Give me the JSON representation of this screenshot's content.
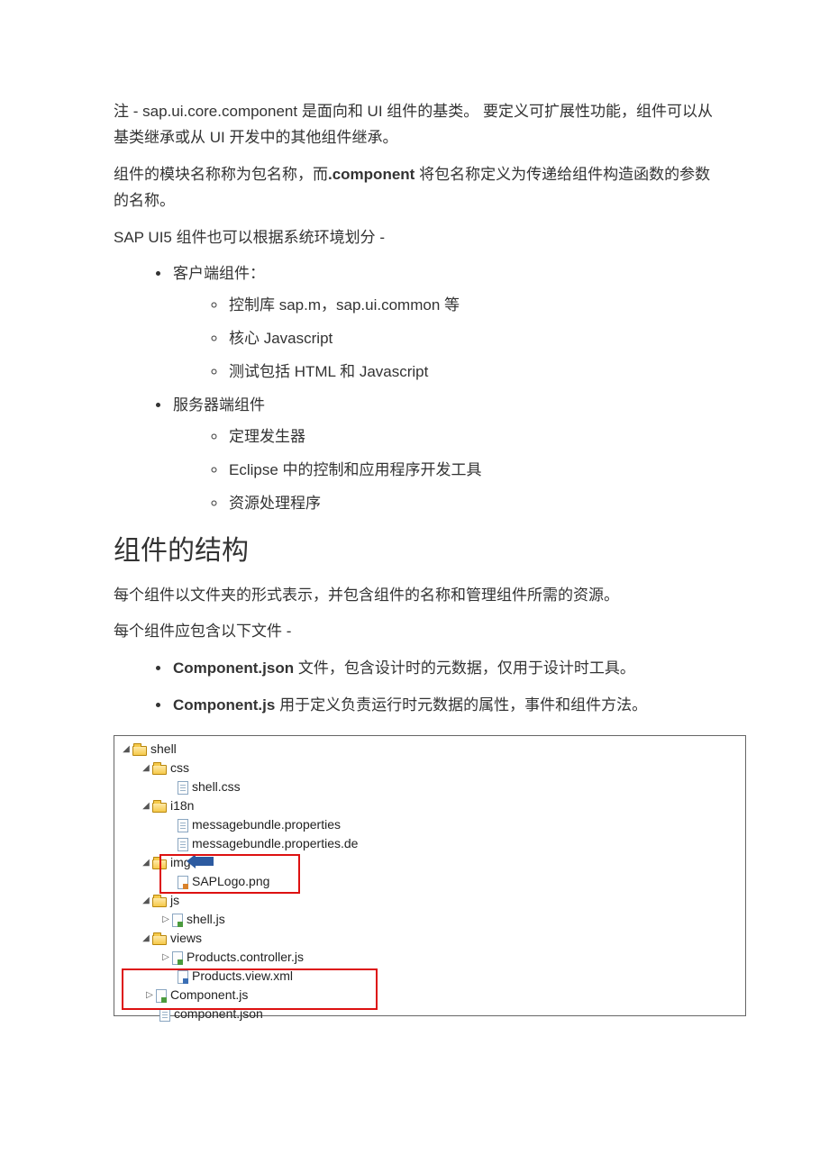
{
  "p1_prefix": "注 - ",
  "p1_code": "sap.ui.core.component",
  "p1_suffix": " 是面向和 UI 组件的基类。  要定义可扩展性功能，组件可以从基类继承或从 UI 开发中的其他组件继承。",
  "p2_prefix": "组件的模块名称称为包名称，而",
  "p2_bold": ".component",
  "p2_suffix": " 将包名称定义为传递给组件构造函数的参数的名称。",
  "p3": "SAP UI5 组件也可以根据系统环境划分 -",
  "list1": {
    "client_label": "客户端组件：",
    "client_items": [
      "控制库 sap.m，sap.ui.common 等",
      "核心 Javascript",
      "测试包括 HTML 和 Javascript"
    ],
    "server_label": "服务器端组件",
    "server_items": [
      "定理发生器",
      "Eclipse 中的控制和应用程序开发工具",
      "资源处理程序"
    ]
  },
  "h2": "组件的结构",
  "p4": "每个组件以文件夹的形式表示，并包含组件的名称和管理组件所需的资源。",
  "p5": "每个组件应包含以下文件 -",
  "files": [
    {
      "bold": "Component.json",
      "rest": " 文件，包含设计时的元数据，仅用于设计时工具。"
    },
    {
      "bold": "Component.js",
      "rest": " 用于定义负责运行时元数据的属性，事件和组件方法。"
    }
  ],
  "tree": {
    "shell": "shell",
    "css": "css",
    "shell_css": "shell.css",
    "i18n": "i18n",
    "mb": "messagebundle.properties",
    "mb_de": "messagebundle.properties.de",
    "img": "img",
    "saplogo": "SAPLogo.png",
    "js": "js",
    "shell_js": "shell.js",
    "views": "views",
    "ctrl": "Products.controller.js",
    "view": "Products.view.xml",
    "comp_js": "Component.js",
    "comp_json": "component.json"
  }
}
